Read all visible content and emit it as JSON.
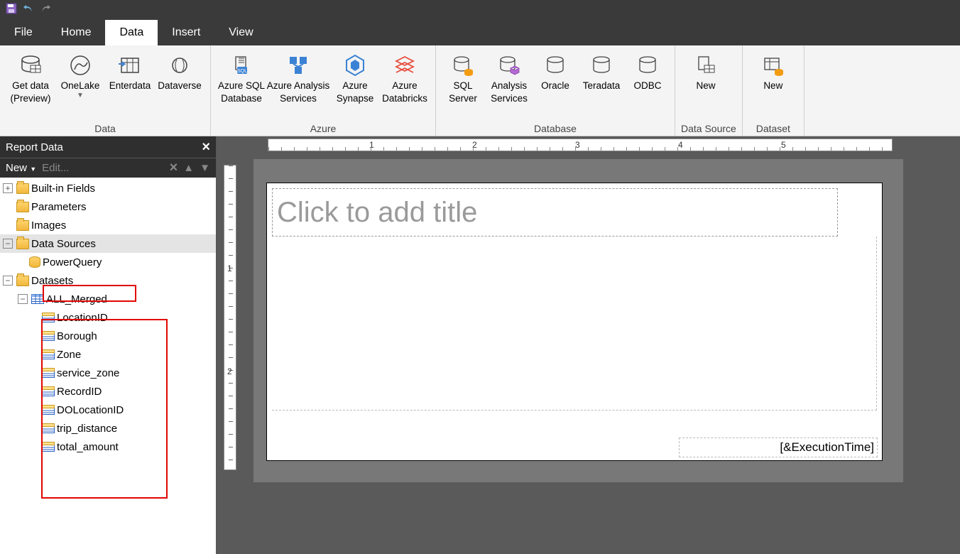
{
  "qat": {
    "save": "save-icon",
    "undo": "undo-icon",
    "redo": "redo-icon"
  },
  "tabs": [
    "File",
    "Home",
    "Data",
    "Insert",
    "View"
  ],
  "active_tab": "Data",
  "ribbon": {
    "groups": [
      {
        "label": "Data",
        "buttons": [
          {
            "id": "get-data",
            "line1": "Get data",
            "line2": "(Preview)",
            "dropdown": false
          },
          {
            "id": "onelake",
            "line1": "OneLake",
            "line2": "",
            "dropdown": true
          },
          {
            "id": "enterdata",
            "line1": "Enterdata",
            "line2": ""
          },
          {
            "id": "dataverse",
            "line1": "Dataverse",
            "line2": ""
          }
        ]
      },
      {
        "label": "Azure",
        "buttons": [
          {
            "id": "azure-sql",
            "line1": "Azure SQL",
            "line2": "Database"
          },
          {
            "id": "azure-analysis",
            "line1": "Azure Analysis",
            "line2": "Services"
          },
          {
            "id": "azure-synapse",
            "line1": "Azure",
            "line2": "Synapse"
          },
          {
            "id": "azure-databricks",
            "line1": "Azure",
            "line2": "Databricks"
          }
        ]
      },
      {
        "label": "Database",
        "buttons": [
          {
            "id": "sql-server",
            "line1": "SQL",
            "line2": "Server"
          },
          {
            "id": "analysis-services",
            "line1": "Analysis",
            "line2": "Services"
          },
          {
            "id": "oracle",
            "line1": "Oracle",
            "line2": ""
          },
          {
            "id": "teradata",
            "line1": "Teradata",
            "line2": ""
          },
          {
            "id": "odbc",
            "line1": "ODBC",
            "line2": ""
          }
        ]
      },
      {
        "label": "Data Source",
        "buttons": [
          {
            "id": "new-ds",
            "line1": "New",
            "line2": ""
          }
        ]
      },
      {
        "label": "Dataset",
        "buttons": [
          {
            "id": "new-dataset",
            "line1": "New",
            "line2": ""
          }
        ]
      }
    ]
  },
  "panel": {
    "title": "Report Data",
    "toolbar": {
      "new": "New",
      "edit": "Edit..."
    },
    "tree": {
      "builtin": "Built-in Fields",
      "parameters": "Parameters",
      "images": "Images",
      "datasources": "Data Sources",
      "ds_item": "PowerQuery",
      "datasets": "Datasets",
      "dataset": "ALL_Merged",
      "fields": [
        "LocationID",
        "Borough",
        "Zone",
        "service_zone",
        "RecordID",
        "DOLocationID",
        "trip_distance",
        "total_amount"
      ]
    }
  },
  "canvas": {
    "title_placeholder": "Click to add title",
    "footer": "[&ExecutionTime]",
    "hruler_marks": [
      "1",
      "2",
      "3",
      "4",
      "5"
    ],
    "vruler_marks": [
      "1",
      "2"
    ]
  }
}
